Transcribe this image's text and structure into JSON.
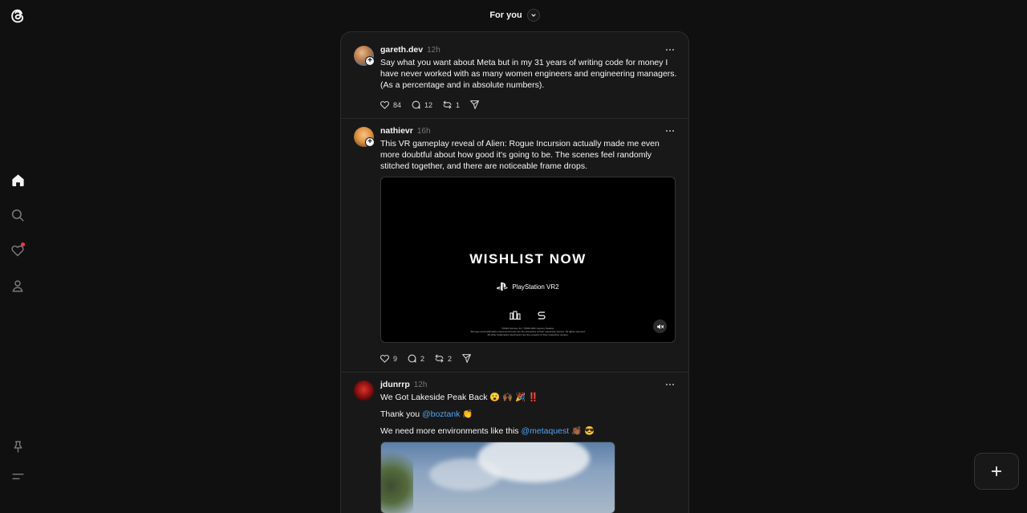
{
  "header": {
    "title": "For you"
  },
  "posts": [
    {
      "username": "gareth.dev",
      "time": "12h",
      "text": "Say what you want about Meta but in my 31 years of writing code for money I have never worked with as many women engineers and engineering managers. (As a percentage and in absolute numbers).",
      "likes": "84",
      "replies": "12",
      "reposts": "1"
    },
    {
      "username": "nathievr",
      "time": "16h",
      "text": "This VR gameplay reveal of Alien: Rogue Incursion actually made me even more doubtful about how good it's going to be. The scenes feel randomly stitched together, and there are noticeable frame drops.",
      "video_title": "WISHLIST NOW",
      "video_platform": "PlayStation VR2",
      "video_legal_1": "©2024 Survios, Inc. ©2024 20th Century Studios.",
      "video_legal_2": "All logos and trademarks referenced herein are the properties of their respective owners. All rights reserved.",
      "video_legal_3": "All other trademarks cited herein are the property of their respective owners.",
      "likes": "9",
      "replies": "2",
      "reposts": "2"
    },
    {
      "username": "jdunrrp",
      "time": "12h",
      "line1": "We Got Lakeside Peak Back 😮 🙌🏾 🎉 ‼️",
      "line2_prefix": "Thank you ",
      "line2_mention": "@boztank",
      "line2_suffix": " 👏",
      "line3_prefix": "We need more environments like this ",
      "line3_mention": "@metaquest",
      "line3_suffix": " 👏🏾 😎"
    }
  ],
  "icons": {
    "logo": "threads-logo-icon",
    "home": "home-icon",
    "search": "search-icon",
    "activity": "heart-icon",
    "profile": "profile-icon",
    "pin": "pin-icon",
    "menu": "menu-icon",
    "create": "plus-icon"
  },
  "colors": {
    "background": "#101010",
    "card": "#181818",
    "mention": "#4ea4f5",
    "notification": "#ff3040"
  }
}
